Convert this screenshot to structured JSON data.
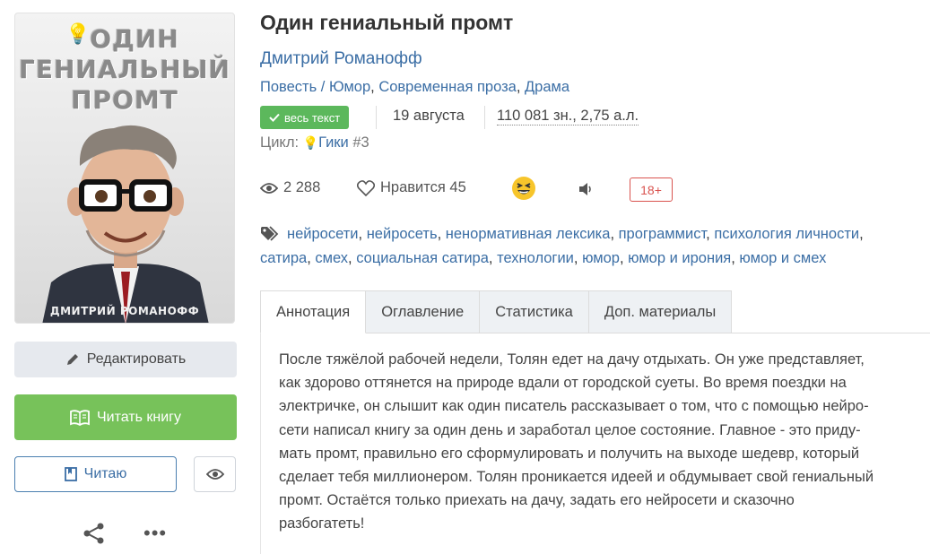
{
  "cover": {
    "title_line1": "ОДИН",
    "title_line2": "ГЕНИАЛЬНЫЙ",
    "title_line3": "ПРОМТ",
    "author": "ДМИТРИЙ РОМАНОФФ"
  },
  "actions": {
    "edit_label": "Редактировать",
    "read_label": "Читать книгу",
    "reading_label": "Читаю"
  },
  "book": {
    "title": "Один гениальный промт",
    "author": "Дмитрий Романофф",
    "genres": [
      "Повесть",
      "Юмор",
      "Современная проза",
      "Драма"
    ],
    "status_badge": "весь текст",
    "date": "19 августа",
    "size": "110 081 зн., 2,75 а.л.",
    "cycle_label": "Цикл:",
    "cycle_name": "Гики",
    "cycle_number": "#3"
  },
  "stats": {
    "views": "2 288",
    "likes": "Нравится 45",
    "age_rating": "18+"
  },
  "tags": [
    "нейросети",
    "нейросеть",
    "ненормативная лексика",
    "программист",
    "психология личности",
    "сатира",
    "смех",
    "социальная сатира",
    "технологии",
    "юмор",
    "юмор и ирония",
    "юмор и смех"
  ],
  "tabs": [
    {
      "label": "Аннотация",
      "active": true
    },
    {
      "label": "Оглавление",
      "active": false
    },
    {
      "label": "Статистика",
      "active": false
    },
    {
      "label": "Доп. материалы",
      "active": false
    }
  ],
  "annotation": [
    "После тяжёлой рабочей недели, Толян едет на дачу отдыхать. Он уже представляет,",
    "как здорово оттянется на природе вдали от городской суеты. Во время поездки на",
    "электричке, он слышит как один писатель рассказывает о том, что с помощью нейро-",
    "сети написал книгу за один день и заработал целое состояние. Главное - это приду-",
    "мать промт, правильно его сформулировать и получить на выходе шедевр, который",
    "сделает тебя миллионером. Толян проникается идеей и обдумывает свой гениальный",
    "промт. Остаётся только приехать на дачу, задать его нейросети и сказочно",
    "разбогатеть!"
  ],
  "colors": {
    "link": "#3b6ea5",
    "read_button": "#77c25a",
    "badge_green": "#5cb85c",
    "age_red": "#d9534f"
  },
  "icons": [
    "lightbulb-icon",
    "pencil-icon",
    "book-open-icon",
    "bookmark-icon",
    "eye-icon",
    "share-icon",
    "more-icon",
    "check-icon",
    "heart-icon",
    "laugh-emoji-icon",
    "speaker-icon",
    "tag-icon"
  ]
}
